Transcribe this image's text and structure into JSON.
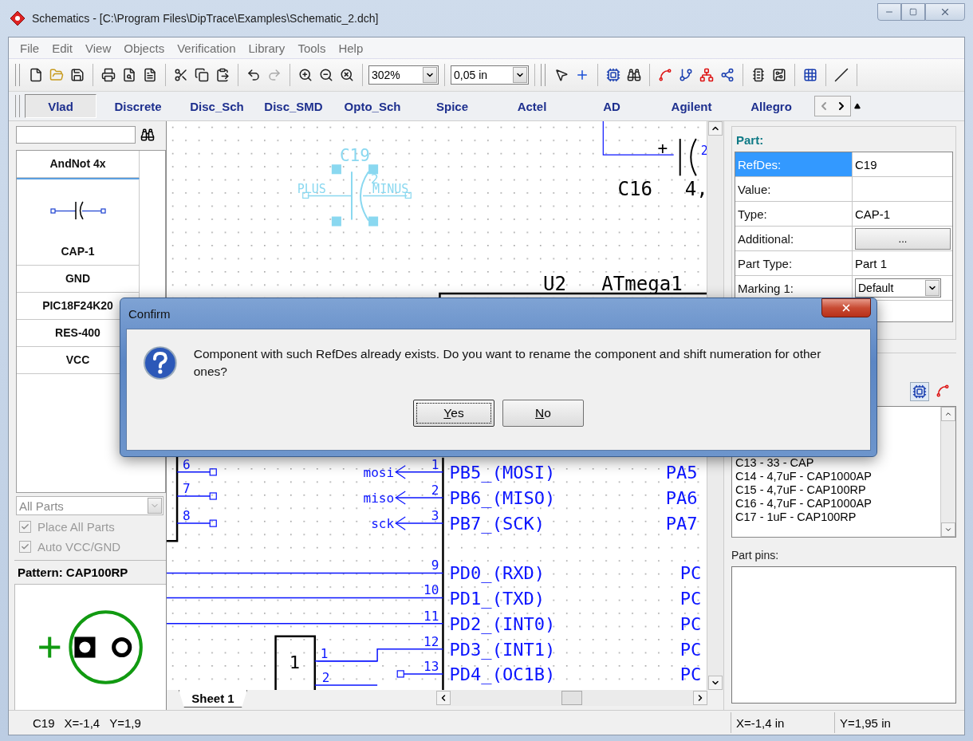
{
  "window": {
    "title": "Schematics - [C:\\Program Files\\DipTrace\\Examples\\Schematic_2.dch]"
  },
  "menu": [
    "File",
    "Edit",
    "View",
    "Objects",
    "Verification",
    "Library",
    "Tools",
    "Help"
  ],
  "toolbar": {
    "zoom": "302%",
    "grid": "0,05 in"
  },
  "library_tabs": [
    {
      "label": "Vlad",
      "selected": true
    },
    {
      "label": "Discrete",
      "selected": false
    },
    {
      "label": "Disc_Sch",
      "selected": false
    },
    {
      "label": "Disc_SMD",
      "selected": false
    },
    {
      "label": "Opto_Sch",
      "selected": false
    },
    {
      "label": "Spice",
      "selected": false
    },
    {
      "label": "Actel",
      "selected": false
    },
    {
      "label": "AD",
      "selected": false
    },
    {
      "label": "Agilent",
      "selected": false
    },
    {
      "label": "Allegro",
      "selected": false
    }
  ],
  "parts": [
    {
      "name": "AndNot 4x",
      "expanded": false
    },
    {
      "name": "CAP-1",
      "expanded": true
    },
    {
      "name": "GND",
      "expanded": false
    },
    {
      "name": "PIC18F24K20",
      "expanded": false
    },
    {
      "name": "RES-400",
      "expanded": false
    },
    {
      "name": "VCC",
      "expanded": false
    }
  ],
  "filter": {
    "value": "All Parts",
    "disabled": true
  },
  "options": [
    {
      "label": "Place All Parts",
      "checked": true,
      "disabled": true
    },
    {
      "label": "Auto VCC/GND",
      "checked": true,
      "disabled": true
    }
  ],
  "pattern": {
    "label": "Pattern: CAP100RP"
  },
  "schematic": {
    "sheet_tab": "Sheet 1",
    "c19": {
      "refdes": "C19",
      "pins": [
        "PLUS",
        "MINUS"
      ],
      "pin_number": "2"
    },
    "c16": {
      "refdes": "C16",
      "value": "4,",
      "polarity": "+",
      "pin_number": "2"
    },
    "u2": {
      "refdes": "U2",
      "value": "ATmega1",
      "left_pins": [
        {
          "number": "1",
          "name": "PB5_(MOSI)",
          "net": "mosi"
        },
        {
          "number": "2",
          "name": "PB6_(MISO)",
          "net": "miso"
        },
        {
          "number": "3",
          "name": "PB7_(SCK)",
          "net": "sck"
        },
        {
          "number": "9",
          "name": "PD0_(RXD)"
        },
        {
          "number": "10",
          "name": "PD1_(TXD)"
        },
        {
          "number": "11",
          "name": "PD2_(INT0)"
        },
        {
          "number": "12",
          "name": "PD3_(INT1)"
        },
        {
          "number": "13",
          "name": "PD4_(OC1B)"
        }
      ],
      "right_pins": [
        "PA5",
        "PA6",
        "PA7",
        "PC",
        "PC",
        "PC",
        "PC",
        "PC"
      ]
    },
    "header": {
      "pins": [
        "6",
        "7",
        "8"
      ]
    },
    "connector": {
      "label": "1",
      "pin_numbers": [
        "1",
        "2"
      ]
    }
  },
  "part_properties": {
    "title": "Part:",
    "rows": [
      {
        "label": "RefDes:",
        "value": "C19",
        "kind": "text",
        "selected": true
      },
      {
        "label": "Value:",
        "kind": "text",
        "selected": false
      },
      {
        "label": "Type:",
        "value": "CAP-1",
        "kind": "text",
        "selected": false
      },
      {
        "label": "Additional:",
        "value": "...",
        "kind": "button",
        "selected": false
      },
      {
        "label": "Part Type:",
        "value": "Part 1",
        "kind": "text",
        "selected": false
      },
      {
        "label": "Marking 1:",
        "value": "Default",
        "kind": "combo",
        "selected": false
      }
    ]
  },
  "components_list": [
    "C13 - 33 - CAP",
    "C14 - 4,7uF - CAP1000AP",
    "C15 - 4,7uF - CAP100RP",
    "C16 - 4,7uF - CAP1000AP",
    "C17 - 1uF - CAP100RP"
  ],
  "part_pins": {
    "label": "Part pins:"
  },
  "status_bar": {
    "cursor": [
      "C19",
      "X=-1,4",
      "Y=1,9"
    ],
    "x": "X=-1,4 in",
    "y": "Y=1,95 in"
  },
  "dialog": {
    "title": "Confirm",
    "message": "Component with such RefDes already exists. Do you want to rename the component and shift numeration for other ones?",
    "buttons": [
      {
        "label": "Yes",
        "default": true
      },
      {
        "label": "No",
        "default": false
      }
    ]
  }
}
